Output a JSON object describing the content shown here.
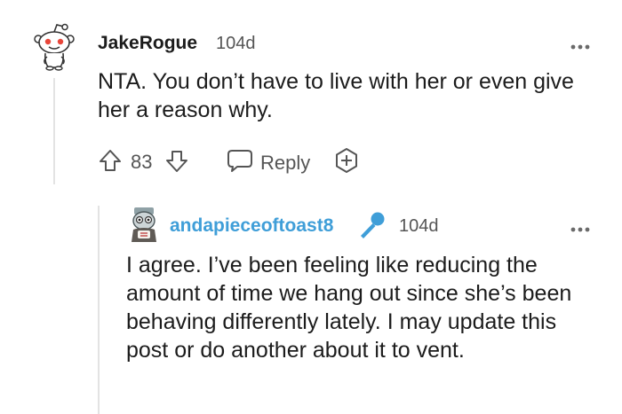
{
  "comment": {
    "username": "JakeRogue",
    "age": "104d",
    "body": "NTA. You don’t have to live with her or even give her a reason why.",
    "votes": "83",
    "reply_label": "Reply"
  },
  "reply": {
    "username": "andapieceoftoast8",
    "age": "104d",
    "body": "I agree. I’ve been feeling like reducing the amount of time we hang out since she’s been behaving differently lately. I may update this post or do another about it to vent."
  },
  "icons": {
    "main_avatar": "snoo-avatar-icon",
    "reply_avatar": "user-avatar-icon",
    "more": "more-options-icon",
    "upvote": "upvote-arrow-icon",
    "downvote": "downvote-arrow-icon",
    "reply": "speech-bubble-icon",
    "award": "award-plus-icon",
    "flair": "microphone-icon"
  },
  "colors": {
    "reply_username": "#3f9ed8",
    "snoo_red": "#e8463a",
    "thread_line": "#e3e3e3"
  }
}
